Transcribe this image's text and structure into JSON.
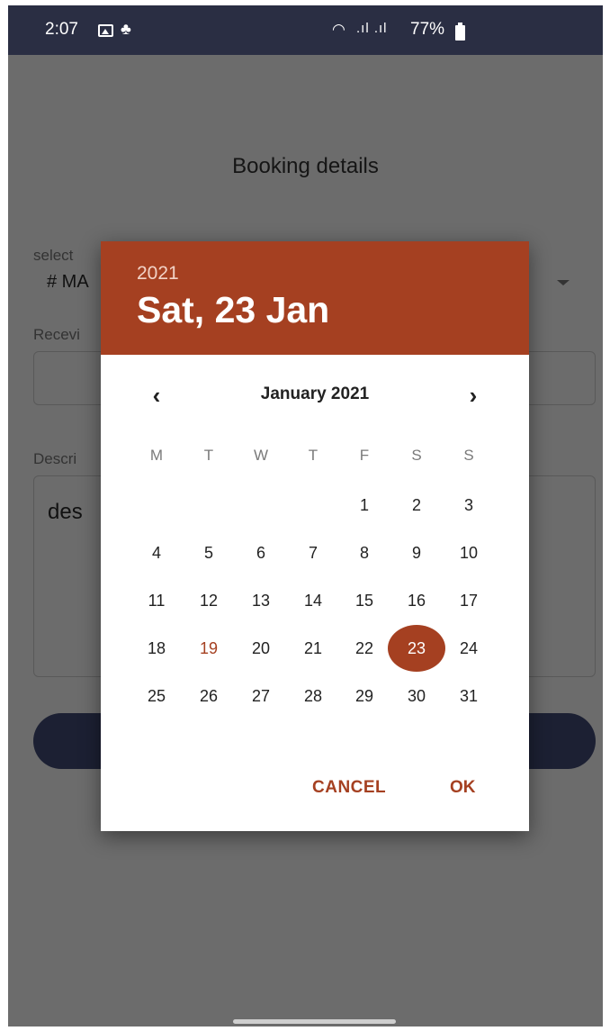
{
  "status_bar": {
    "time": "2:07",
    "battery_percent": "77%",
    "icons": [
      "gallery-icon",
      "app-notification-icon",
      "wifi-icon",
      "signal-icon",
      "battery-icon"
    ]
  },
  "form": {
    "title": "Booking details",
    "select_label": "select",
    "select_value": "# MA",
    "receiver_label": "Recevi",
    "description_label": "Descri",
    "description_value": "des"
  },
  "date_picker": {
    "header_year": "2021",
    "header_date": "Sat, 23 Jan",
    "month_title": "January 2021",
    "prev_icon": "‹",
    "next_icon": "›",
    "weekdays": [
      "M",
      "T",
      "W",
      "T",
      "F",
      "S",
      "S"
    ],
    "first_day_column": 4,
    "days_in_month": 31,
    "today": 19,
    "selected": 23,
    "cancel_label": "CANCEL",
    "ok_label": "OK",
    "accent_color": "#a54021"
  }
}
